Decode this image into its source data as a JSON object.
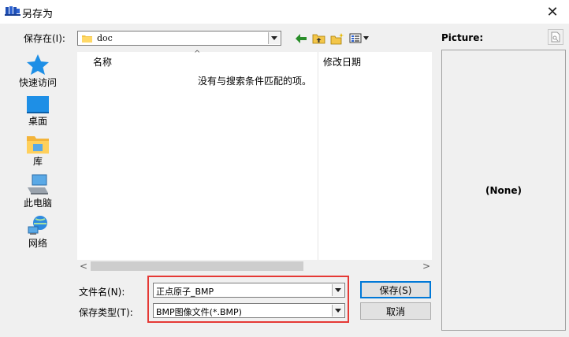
{
  "window": {
    "title": "另存为",
    "close_glyph": "✕"
  },
  "save_in": {
    "label": "保存在(I):",
    "value": "doc"
  },
  "places": [
    {
      "label": "快速访问",
      "icon": "star-icon"
    },
    {
      "label": "桌面",
      "icon": "desktop-icon"
    },
    {
      "label": "库",
      "icon": "library-icon"
    },
    {
      "label": "此电脑",
      "icon": "computer-icon"
    },
    {
      "label": "网络",
      "icon": "network-icon"
    }
  ],
  "file_list": {
    "columns": [
      "名称",
      "修改日期"
    ],
    "empty_message": "没有与搜索条件匹配的项。",
    "scroll_left": "<",
    "scroll_right": ">"
  },
  "filename": {
    "label": "文件名(N):",
    "value": "正点原子_BMP"
  },
  "filetype": {
    "label": "保存类型(T):",
    "value": "BMP图像文件(*.BMP)"
  },
  "buttons": {
    "save": "保存(S)",
    "cancel": "取消"
  },
  "preview": {
    "label": "Picture:",
    "none_text": "(None)"
  },
  "colors": {
    "highlight": "#e53935",
    "accent": "#0078d7"
  }
}
